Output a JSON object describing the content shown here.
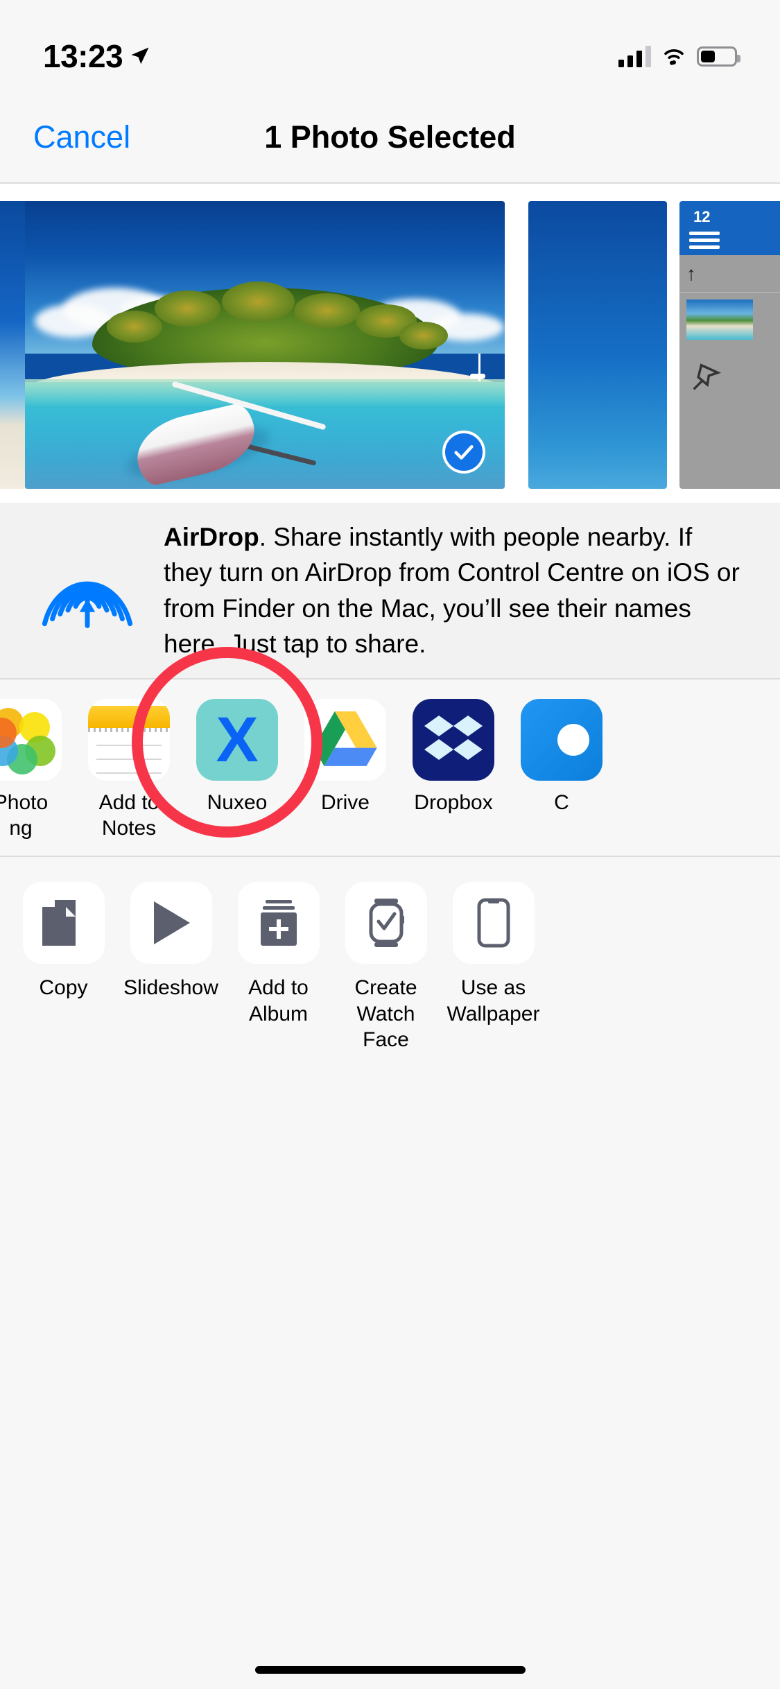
{
  "status_bar": {
    "time": "13:23",
    "location_icon": "location-arrow-icon",
    "cellular_icon": "cellular-bars-icon",
    "wifi_icon": "wifi-icon",
    "battery_icon": "battery-icon",
    "battery_level_percent": 40
  },
  "nav": {
    "cancel_label": "Cancel",
    "title": "1 Photo Selected",
    "cancel_color": "#007AFF"
  },
  "photo_strip": {
    "selected_badge_icon": "checkmark-circle-icon",
    "selected_badge_color": "#1273E6",
    "items": [
      {
        "name": "previous-photo-thumbnail",
        "selected": false
      },
      {
        "name": "selected-photo-thumbnail",
        "selected": true
      },
      {
        "name": "next-photo-thumbnail",
        "selected": false
      },
      {
        "name": "screenshot-thumbnail",
        "selected": false
      }
    ]
  },
  "airdrop": {
    "icon": "airdrop-icon",
    "icon_color": "#007AFF",
    "title": "AirDrop",
    "body": ". Share instantly with people nearby. If they turn on AirDrop from Control Centre on iOS or from Finder on the Mac, you’ll see their names here. Just tap to share."
  },
  "app_row": {
    "apps": [
      {
        "label": "Photo\nng",
        "icon": "photos-app-icon",
        "truncated": true
      },
      {
        "label": "Add to Notes",
        "icon": "notes-app-icon",
        "truncated": false
      },
      {
        "label": "Nuxeo",
        "icon": "nuxeo-app-icon",
        "truncated": false
      },
      {
        "label": "Drive",
        "icon": "google-drive-app-icon",
        "truncated": false
      },
      {
        "label": "Dropbox",
        "icon": "dropbox-app-icon",
        "truncated": false
      },
      {
        "label": "C",
        "icon": "blue-cloud-app-icon",
        "truncated": true
      }
    ]
  },
  "action_row": {
    "actions": [
      {
        "label": "Copy",
        "icon": "copy-icon"
      },
      {
        "label": "Slideshow",
        "icon": "play-triangle-icon"
      },
      {
        "label": "Add to Album",
        "icon": "add-to-album-icon"
      },
      {
        "label": "Create\nWatch Face",
        "icon": "watch-face-icon"
      },
      {
        "label": "Use as\nWallpaper",
        "icon": "iphone-wallpaper-icon"
      }
    ]
  },
  "annotation": {
    "shape": "circle-highlight",
    "color": "#F73549",
    "target": "Nuxeo"
  },
  "home_indicator": {
    "name": "home-indicator"
  }
}
